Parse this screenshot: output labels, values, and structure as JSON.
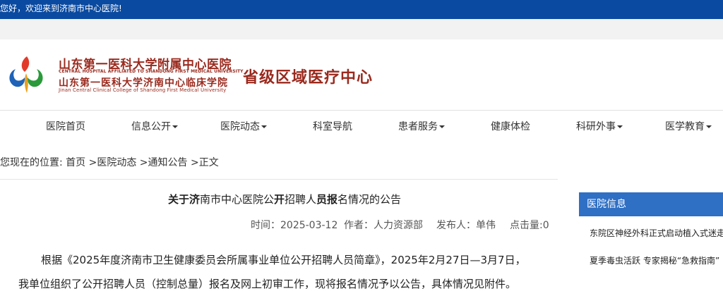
{
  "topbar": {
    "welcome": "您好，欢迎来到济南市中心医院!"
  },
  "header": {
    "name_cn": "山东第一医科大学附属中心医院",
    "name_en": "CENTRAL HOSPITAL AFFILIATED TO SHANDONG FIRST MEDICAL UNIVERSITY",
    "college_cn": "山东第一医科大学济南中心临床学院",
    "college_en": "Jinan Central Clinical College of Shandong First Medical University",
    "slogan": "省级区域医疗中心"
  },
  "nav": {
    "items": [
      {
        "label": "医院首页",
        "dropdown": false
      },
      {
        "label": "信息公开",
        "dropdown": true
      },
      {
        "label": "医院动态",
        "dropdown": true
      },
      {
        "label": "科室导航",
        "dropdown": false
      },
      {
        "label": "患者服务",
        "dropdown": true
      },
      {
        "label": "健康体检",
        "dropdown": false
      },
      {
        "label": "科研外事",
        "dropdown": true
      },
      {
        "label": "医学教育",
        "dropdown": true
      }
    ]
  },
  "breadcrumb": {
    "prefix": "您现在的位置: ",
    "home": "首页",
    "sep1": " >",
    "level1": "医院动态",
    "sep2": " >",
    "level2": "通知公告",
    "sep3": " >",
    "current": "正文"
  },
  "article": {
    "title_parts": [
      "关于",
      "济",
      "南市中心医院公",
      "开",
      "招聘人",
      "员报",
      "名情况的公告"
    ],
    "time_label": "时间：",
    "time": "2025-03-12",
    "author_label": "作者：",
    "author": "人力资源部",
    "publisher_label": "发布人：",
    "publisher": "单伟",
    "clicks_label": "点击量:",
    "clicks": "0",
    "para1": "根据《2025年度济南市卫生健康委员会所属事业单位公开招聘人员简章》，2025年2月27日—3月7日，",
    "para2": "我单位组织了公开招聘人员（控制总量）报名及网上初审工作，现将报名情况予以公告，具体情况见附件。"
  },
  "sidebar": {
    "heading": "医院信息",
    "items": [
      "东院区神经外科正式启动植入式迷走神经",
      "夏季毒虫活跃 专家揭秘“急救指南”"
    ]
  },
  "colors": {
    "topbar": "#0a4aa0",
    "brand_red": "#9a2a1e",
    "side_head": "#2f6fc4"
  }
}
